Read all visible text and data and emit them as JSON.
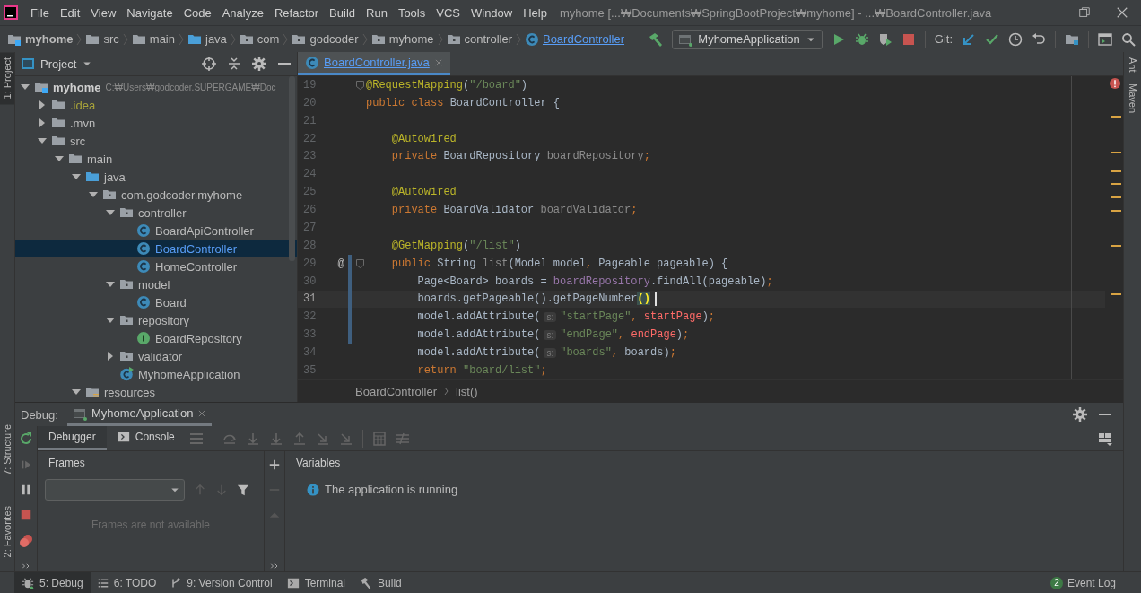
{
  "menu_bar": {
    "items": [
      "File",
      "Edit",
      "View",
      "Navigate",
      "Code",
      "Analyze",
      "Refactor",
      "Build",
      "Run",
      "Tools",
      "VCS",
      "Window",
      "Help"
    ],
    "title": "myhome [...₩Documents₩SpringBootProject₩myhome] - ...₩BoardController.java"
  },
  "nav_bar": {
    "breadcrumbs": [
      {
        "label": "myhome",
        "kind": "module"
      },
      {
        "label": "src",
        "kind": "folder"
      },
      {
        "label": "main",
        "kind": "folder"
      },
      {
        "label": "java",
        "kind": "source_folder"
      },
      {
        "label": "com",
        "kind": "package"
      },
      {
        "label": "godcoder",
        "kind": "package"
      },
      {
        "label": "myhome",
        "kind": "package"
      },
      {
        "label": "controller",
        "kind": "package"
      },
      {
        "label": "BoardController",
        "kind": "class"
      }
    ],
    "run_configuration": "MyhomeApplication",
    "vcs_label": "Git:"
  },
  "left_strip": [
    {
      "label": "1: Project",
      "selected": true
    },
    {
      "label": "7: Structure",
      "selected": false
    },
    {
      "label": "2: Favorites",
      "selected": false
    }
  ],
  "right_strip": [
    "Ant",
    "Maven"
  ],
  "project_panel": {
    "title": "Project",
    "tree": [
      {
        "label": "myhome",
        "kind": "module",
        "path": "C:₩Users₩godcoder.SUPERGAME₩Doc",
        "expanded": true,
        "selected": false,
        "children": [
          {
            "label": ".idea",
            "kind": "ignored_folder",
            "expanded": false,
            "selected": false
          },
          {
            "label": ".mvn",
            "kind": "folder",
            "expanded": false,
            "selected": false
          },
          {
            "label": "src",
            "kind": "folder",
            "expanded": true,
            "selected": false,
            "children": [
              {
                "label": "main",
                "kind": "folder",
                "expanded": true,
                "selected": false,
                "children": [
                  {
                    "label": "java",
                    "kind": "source_folder",
                    "expanded": true,
                    "selected": false,
                    "children": [
                      {
                        "label": "com.godcoder.myhome",
                        "kind": "package",
                        "expanded": true,
                        "selected": false,
                        "children": [
                          {
                            "label": "controller",
                            "kind": "package",
                            "expanded": true,
                            "selected": false,
                            "children": [
                              {
                                "label": "BoardApiController",
                                "kind": "class",
                                "selected": false
                              },
                              {
                                "label": "BoardController",
                                "kind": "class",
                                "selected": true
                              },
                              {
                                "label": "HomeController",
                                "kind": "class",
                                "selected": false
                              }
                            ]
                          },
                          {
                            "label": "model",
                            "kind": "package",
                            "expanded": true,
                            "selected": false,
                            "children": [
                              {
                                "label": "Board",
                                "kind": "class",
                                "selected": false
                              }
                            ]
                          },
                          {
                            "label": "repository",
                            "kind": "package",
                            "expanded": true,
                            "selected": false,
                            "children": [
                              {
                                "label": "BoardRepository",
                                "kind": "interface",
                                "selected": false
                              }
                            ]
                          },
                          {
                            "label": "validator",
                            "kind": "package",
                            "expanded": false,
                            "selected": false
                          },
                          {
                            "label": "MyhomeApplication",
                            "kind": "app_class",
                            "selected": false
                          }
                        ]
                      }
                    ]
                  },
                  {
                    "label": "resources",
                    "kind": "resources_folder",
                    "expanded": true,
                    "selected": false
                  }
                ]
              }
            ]
          }
        ]
      }
    ]
  },
  "editor": {
    "tabs": [
      {
        "label": "BoardController.java",
        "selected": true
      }
    ],
    "lines": [
      {
        "number": "19",
        "fold": true,
        "changed": false,
        "current": false,
        "tokens": [
          {
            "text": "@RequestMapping",
            "kind": "annotation"
          },
          {
            "text": "(",
            "kind": "plain"
          },
          {
            "text": "\"/board\"",
            "kind": "string"
          },
          {
            "text": ")",
            "kind": "plain"
          }
        ]
      },
      {
        "number": "20",
        "fold": false,
        "changed": false,
        "current": false,
        "tokens": [
          {
            "text": "public class ",
            "kind": "keyword"
          },
          {
            "text": "BoardController {",
            "kind": "plain"
          }
        ]
      },
      {
        "number": "21",
        "fold": false,
        "changed": false,
        "current": false
      },
      {
        "number": "22",
        "fold": false,
        "changed": false,
        "current": false,
        "tokens": [
          {
            "text": "    @Autowired",
            "kind": "annotation"
          }
        ]
      },
      {
        "number": "23",
        "fold": false,
        "changed": false,
        "current": false,
        "tokens": [
          {
            "text": "    private ",
            "kind": "keyword"
          },
          {
            "text": "BoardRepository ",
            "kind": "plain"
          },
          {
            "text": "boardRepository",
            "kind": "unused"
          },
          {
            "text": ";",
            "kind": "keyword"
          }
        ]
      },
      {
        "number": "24",
        "fold": false,
        "changed": false,
        "current": false
      },
      {
        "number": "25",
        "fold": false,
        "changed": false,
        "current": false,
        "tokens": [
          {
            "text": "    @Autowired",
            "kind": "annotation"
          }
        ]
      },
      {
        "number": "26",
        "fold": false,
        "changed": false,
        "current": false,
        "tokens": [
          {
            "text": "    private ",
            "kind": "keyword"
          },
          {
            "text": "BoardValidator ",
            "kind": "plain"
          },
          {
            "text": "boardValidator",
            "kind": "unused"
          },
          {
            "text": ";",
            "kind": "keyword"
          }
        ]
      },
      {
        "number": "27",
        "fold": false,
        "changed": false,
        "current": false
      },
      {
        "number": "28",
        "fold": false,
        "changed": false,
        "current": false,
        "tokens": [
          {
            "text": "    @GetMapping",
            "kind": "annotation"
          },
          {
            "text": "(",
            "kind": "plain"
          },
          {
            "text": "\"/list\"",
            "kind": "string"
          },
          {
            "text": ")",
            "kind": "plain"
          }
        ]
      },
      {
        "number": "29",
        "marker": "@",
        "fold": true,
        "changed": true,
        "current": false,
        "tokens": [
          {
            "text": "    public ",
            "kind": "keyword"
          },
          {
            "text": "String ",
            "kind": "plain"
          },
          {
            "text": "list",
            "kind": "unused"
          },
          {
            "text": "(Model model",
            "kind": "plain"
          },
          {
            "text": ", ",
            "kind": "keyword"
          },
          {
            "text": "Pageable pageable) {",
            "kind": "plain"
          }
        ]
      },
      {
        "number": "30",
        "fold": false,
        "changed": true,
        "current": false,
        "tokens": [
          {
            "text": "        Page<Board> boards = ",
            "kind": "plain"
          },
          {
            "text": "boardRepository",
            "kind": "field"
          },
          {
            "text": ".findAll(pageable)",
            "kind": "plain"
          },
          {
            "text": ";",
            "kind": "keyword"
          }
        ]
      },
      {
        "number": "31",
        "fold": false,
        "changed": true,
        "current": true,
        "tokens": [
          {
            "text": "        boards.getPageable().getPageNumber",
            "kind": "plain"
          },
          {
            "text": "()",
            "kind": "match"
          }
        ]
      },
      {
        "number": "32",
        "fold": false,
        "changed": true,
        "current": false,
        "tokens": [
          {
            "text": "        model.addAttribute(",
            "kind": "plain"
          },
          {
            "text": "s:",
            "kind": "hint"
          },
          {
            "text": "\"startPage\"",
            "kind": "string"
          },
          {
            "text": ", ",
            "kind": "keyword"
          },
          {
            "text": "startPage",
            "kind": "error"
          },
          {
            "text": ")",
            "kind": "plain"
          },
          {
            "text": ";",
            "kind": "keyword"
          }
        ]
      },
      {
        "number": "33",
        "fold": false,
        "changed": true,
        "current": false,
        "tokens": [
          {
            "text": "        model.addAttribute(",
            "kind": "plain"
          },
          {
            "text": "s:",
            "kind": "hint"
          },
          {
            "text": "\"endPage\"",
            "kind": "string"
          },
          {
            "text": ", ",
            "kind": "keyword"
          },
          {
            "text": "endPage",
            "kind": "error"
          },
          {
            "text": ")",
            "kind": "plain"
          },
          {
            "text": ";",
            "kind": "keyword"
          }
        ]
      },
      {
        "number": "34",
        "fold": false,
        "changed": false,
        "current": false,
        "tokens": [
          {
            "text": "        model.addAttribute(",
            "kind": "plain"
          },
          {
            "text": "s:",
            "kind": "hint"
          },
          {
            "text": "\"boards\"",
            "kind": "string"
          },
          {
            "text": ", ",
            "kind": "keyword"
          },
          {
            "text": "boards)",
            "kind": "plain"
          },
          {
            "text": ";",
            "kind": "keyword"
          }
        ]
      },
      {
        "number": "35",
        "fold": false,
        "changed": false,
        "current": false,
        "tokens": [
          {
            "text": "        return ",
            "kind": "keyword"
          },
          {
            "text": "\"board/list\"",
            "kind": "string"
          },
          {
            "text": ";",
            "kind": "keyword"
          }
        ]
      }
    ],
    "breadcrumbs": [
      "BoardController",
      "list()"
    ]
  },
  "debug_panel": {
    "label": "Debug:",
    "session_tab": "MyhomeApplication",
    "tabs": [
      {
        "label": "Debugger",
        "selected": true
      },
      {
        "label": "Console",
        "selected": false
      }
    ],
    "frames": {
      "title": "Frames",
      "empty_text": "Frames are not available"
    },
    "variables": {
      "title": "Variables",
      "message": "The application is running"
    }
  },
  "status_bar": {
    "tool_windows": [
      {
        "label": "5: Debug",
        "kind": "debug",
        "selected": true
      },
      {
        "label": "6: TODO",
        "kind": "todo",
        "selected": false
      },
      {
        "label": "9: Version Control",
        "kind": "vcs",
        "selected": false
      },
      {
        "label": "Terminal",
        "kind": "terminal",
        "selected": false
      },
      {
        "label": "Build",
        "kind": "build",
        "selected": false
      }
    ],
    "event_log": {
      "count": "2",
      "label": "Event Log"
    }
  }
}
